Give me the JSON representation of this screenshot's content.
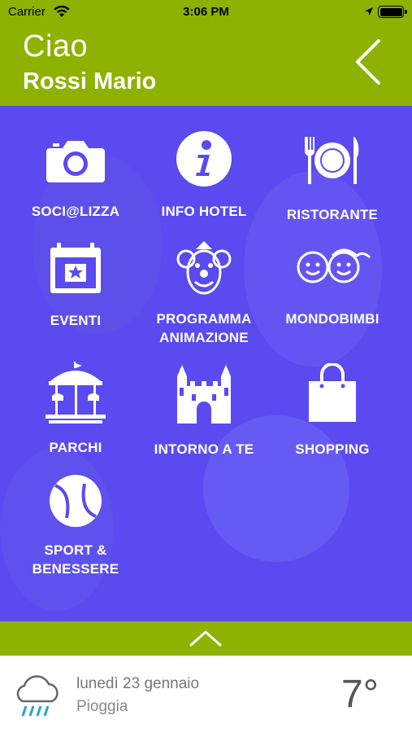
{
  "status_bar": {
    "carrier": "Carrier",
    "time": "3:06 PM",
    "wifi_icon": "wifi-icon",
    "location_icon": "location-arrow-icon",
    "battery_icon": "battery-icon"
  },
  "header": {
    "greeting": "Ciao",
    "username": "Rossi Mario",
    "back_icon": "chevron-left-icon"
  },
  "menu": {
    "items": [
      {
        "label": "SOCI@LIZZA",
        "icon": "camera-icon"
      },
      {
        "label": "INFO HOTEL",
        "icon": "info-icon"
      },
      {
        "label": "RISTORANTE",
        "icon": "cutlery-plate-icon"
      },
      {
        "label": "EVENTI",
        "icon": "calendar-star-icon"
      },
      {
        "label": "PROGRAMMA ANIMAZIONE",
        "line1": "PROGRAMMA",
        "line2": "ANIMAZIONE",
        "icon": "clown-icon"
      },
      {
        "label": "MONDOBIMBI",
        "icon": "kids-faces-icon"
      },
      {
        "label": "PARCHI",
        "icon": "carousel-icon"
      },
      {
        "label": "INTORNO A TE",
        "icon": "castle-icon"
      },
      {
        "label": "SHOPPING",
        "icon": "shopping-bag-icon"
      },
      {
        "label": "SPORT & BENESSERE",
        "line1": "SPORT &",
        "line2": "BENESSERE",
        "icon": "tennis-ball-icon"
      }
    ]
  },
  "drawer": {
    "toggle_icon": "chevron-up-icon"
  },
  "weather": {
    "date": "lunedì 23 gennaio",
    "condition": "Pioggia",
    "temperature": "7°",
    "icon": "rain-cloud-icon"
  },
  "colors": {
    "brand_green": "#8db200",
    "overlay_blue": "#5a4af0",
    "text_white": "#ffffff"
  }
}
